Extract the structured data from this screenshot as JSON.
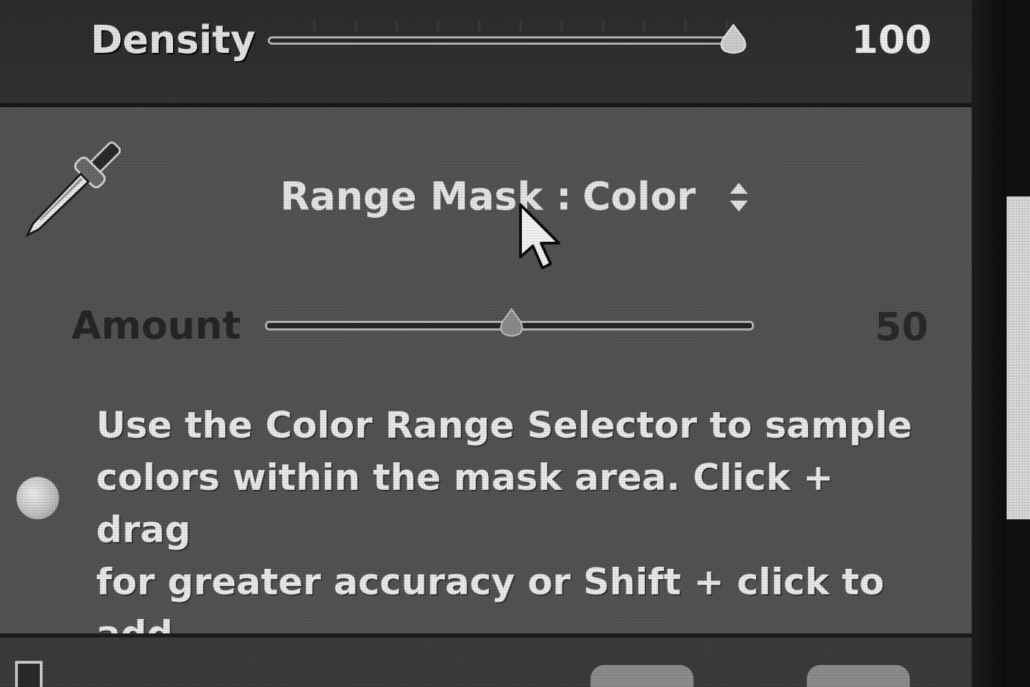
{
  "density": {
    "label": "Density",
    "value": "100",
    "level": 1.0
  },
  "range_mask": {
    "label": "Range Mask :",
    "mode": "Color"
  },
  "amount": {
    "label": "Amount",
    "value": "50",
    "level": 0.5
  },
  "help": {
    "text": "Use the Color Range Selector to sample\ncolors within the mask area. Click + drag\nfor greater accuracy or Shift + click to add\nmultiple samples."
  },
  "icons": {
    "eyedropper": "eyedropper-icon",
    "stepper": "up-down-arrows-icon",
    "cursor": "mouse-pointer-icon",
    "info_dot": "circle-indicator-icon"
  },
  "colors": {
    "panel": "#545454",
    "header": "#2c2c2c",
    "text": "#e8e8e8"
  }
}
